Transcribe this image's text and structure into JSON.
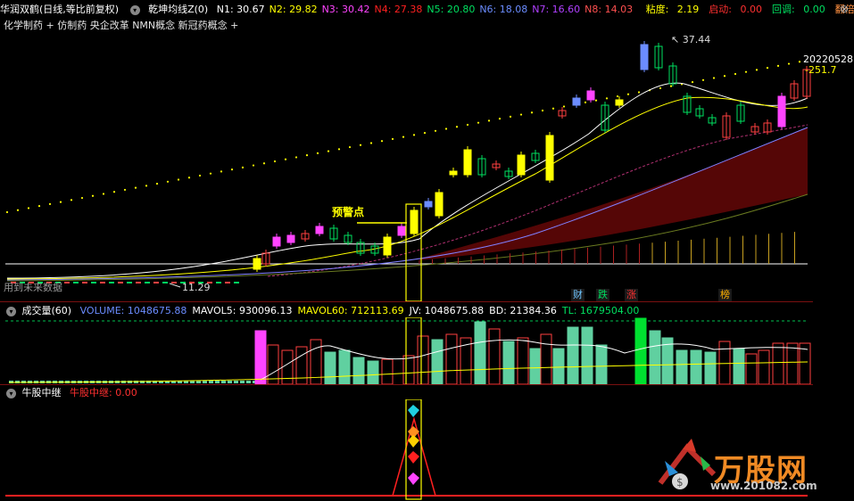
{
  "header": {
    "title": "华润双鹤(日线,等比前复权)",
    "indicator_name": "乾坤均线Z(0)",
    "n_values": [
      {
        "label": "N1: 30.67",
        "color": "#ffffff"
      },
      {
        "label": "N2: 29.82",
        "color": "#ffff00"
      },
      {
        "label": "N3: 30.42",
        "color": "#ff44ff"
      },
      {
        "label": "N4: 27.38",
        "color": "#ff2020"
      },
      {
        "label": "N5: 20.80",
        "color": "#00e060"
      },
      {
        "label": "N6: 18.08",
        "color": "#6b8cff"
      },
      {
        "label": "N7: 16.60",
        "color": "#b040ff"
      },
      {
        "label": "N8: 14.03",
        "color": "#ff5050"
      }
    ],
    "extras": [
      {
        "label": "粘度: ",
        "value": "2.19",
        "label_color": "#ffff00",
        "value_color": "#ffff00"
      },
      {
        "label": "启动: ",
        "value": "0.00",
        "label_color": "#ff3030",
        "value_color": "#ff3030"
      },
      {
        "label": "回调: ",
        "value": "0.00",
        "label_color": "#00e060",
        "value_color": "#00e060"
      },
      {
        "label": "翻倍: ",
        "value": "0.",
        "label_color": "#ff9040",
        "value_color": "#ff9040"
      }
    ]
  },
  "concepts": "化学制药 + 仿制药 央企改革 NMN概念 新冠药概念 +",
  "chart": {
    "high_label": "37.44",
    "low_label": "11.29",
    "date_label": "20220528",
    "price_label": "-251.7",
    "warning_label": "预警点",
    "left_note": "用到未来数据",
    "badges": [
      {
        "text": "财",
        "color": "#6ec4ff",
        "bg": "#1a1a1a"
      },
      {
        "text": "跌",
        "color": "#00e060",
        "bg": "#1a1a1a"
      },
      {
        "text": "涨",
        "color": "#ff3030",
        "bg": "#1a1a1a"
      },
      {
        "text": "榜",
        "color": "#ffb000",
        "bg": "#1a1a1a"
      }
    ]
  },
  "volume": {
    "title": "成交量(60)",
    "items": [
      {
        "label": "VOLUME: 1048675.88",
        "color": "#6b8cff"
      },
      {
        "label": "MAVOL5: 930096.13",
        "color": "#ffffff"
      },
      {
        "label": "MAVOL60: 712113.69",
        "color": "#ffff00"
      },
      {
        "label": "JV: 1048675.88",
        "color": "#ffffff"
      },
      {
        "label": "BD: 21384.36",
        "color": "#ffffff"
      },
      {
        "label": "TL: 1679504.00",
        "color": "#00e060"
      }
    ]
  },
  "gain": {
    "title": "牛股中继",
    "value_label": "牛股中继: 0.00"
  },
  "watermark": {
    "brand": "万股网",
    "url": "www.201082.com"
  }
}
